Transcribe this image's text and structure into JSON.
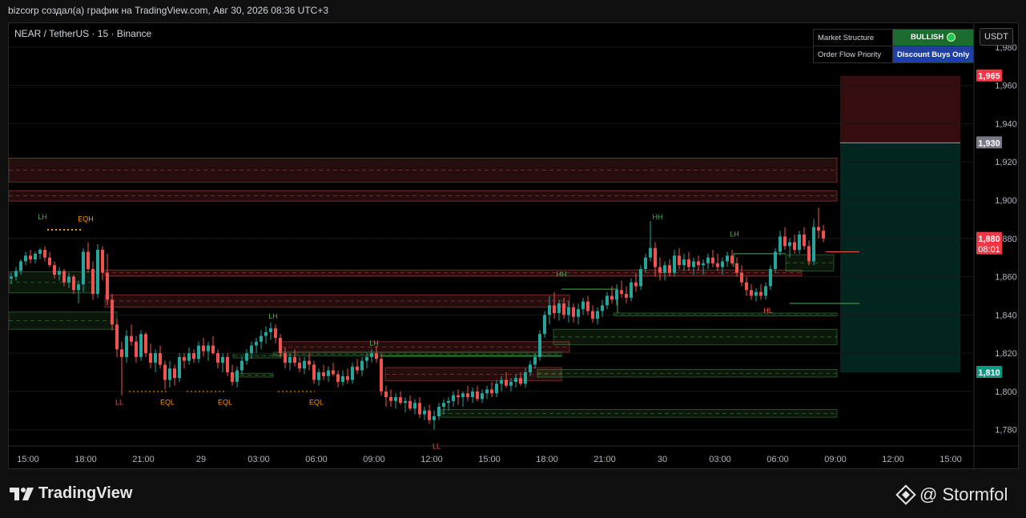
{
  "header": {
    "title": "bizcorp создал(а) график на TradingView.com, Авг 30, 2026 08:36 UTC+3"
  },
  "legend": {
    "symbol": "NEAR / TetherUS · 15 · Binance"
  },
  "status_table": {
    "rows": [
      {
        "label": "Market Structure",
        "value": "BULLISH",
        "color": "#1c6b2f"
      },
      {
        "label": "Order Flow Priority",
        "value": "Discount Buys Only",
        "color": "#1e3fa8"
      }
    ]
  },
  "currency": "USDT",
  "footer": {
    "brand": "TradingView",
    "watermark": "@ Stormfol"
  },
  "colors": {
    "bull": "#26a69a",
    "bear": "#ef5350",
    "structure_green": "#4caf50",
    "structure_red": "#ef5350",
    "eq_orange": "#ff9800"
  },
  "chart_data": {
    "type": "candlestick",
    "price_axis": {
      "ticks": [
        1.78,
        1.8,
        1.82,
        1.84,
        1.86,
        1.88,
        1.9,
        1.92,
        1.94,
        1.96,
        1.98
      ],
      "tick_labels": [
        "1,780",
        "1,800",
        "1,820",
        "1,840",
        "1,860",
        "1,880",
        "1,900",
        "1,920",
        "1,940",
        "1,960",
        "1,980"
      ],
      "ylim": [
        1.7715,
        1.9925
      ]
    },
    "time_axis": {
      "labels": [
        "15:00",
        "18:00",
        "21:00",
        "29",
        "03:00",
        "06:00",
        "09:00",
        "12:00",
        "15:00",
        "18:00",
        "21:00",
        "30",
        "03:00",
        "06:00",
        "09:00",
        "12:00",
        "15:00"
      ],
      "label_bars": [
        4,
        16,
        28,
        40,
        52,
        64,
        76,
        88,
        100,
        112,
        124,
        136,
        148,
        160,
        172,
        184,
        196
      ],
      "total_bars": 201
    },
    "price_markers": [
      {
        "label": "1,965",
        "value": 1.965,
        "color": "#f23645",
        "text_color": "#ffffff"
      },
      {
        "label": "1,930",
        "value": 1.93,
        "color": "#787b86",
        "text_color": "#ffffff"
      },
      {
        "label": "1,880",
        "sub": "08:01",
        "value": 1.88,
        "color": "#f23645",
        "text_color": "#ffffff"
      },
      {
        "label": "1,810",
        "value": 1.81,
        "color": "#089981",
        "text_color": "#ffffff"
      }
    ],
    "current_price": 1.88,
    "position": {
      "stop": 1.965,
      "entry": 1.93,
      "target": 1.81,
      "from_bar": 173,
      "to_bar": 198
    },
    "structure_labels": [
      {
        "text": "LH",
        "bar": 7,
        "price": 1.89,
        "color": "#4caf50"
      },
      {
        "text": "EQH",
        "bar": 16,
        "price": 1.889,
        "color": "#ff9800"
      },
      {
        "text": "LL",
        "bar": 23,
        "price": 1.793,
        "color": "#ef5350"
      },
      {
        "text": "EQL",
        "bar": 33,
        "price": 1.793,
        "color": "#ff9800"
      },
      {
        "text": "EQL",
        "bar": 45,
        "price": 1.793,
        "color": "#ff9800"
      },
      {
        "text": "LH",
        "bar": 55,
        "price": 1.838,
        "color": "#4caf50"
      },
      {
        "text": "EQL",
        "bar": 64,
        "price": 1.793,
        "color": "#ff9800"
      },
      {
        "text": "LH",
        "bar": 76,
        "price": 1.824,
        "color": "#4caf50"
      },
      {
        "text": "LL",
        "bar": 89,
        "price": 1.77,
        "color": "#ef5350"
      },
      {
        "text": "HH",
        "bar": 115,
        "price": 1.86,
        "color": "#4caf50"
      },
      {
        "text": "HH",
        "bar": 135,
        "price": 1.89,
        "color": "#4caf50"
      },
      {
        "text": "LH",
        "bar": 151,
        "price": 1.881,
        "color": "#4caf50"
      },
      {
        "text": "HL",
        "bar": 158,
        "price": 1.841,
        "color": "#ef5350"
      }
    ],
    "candles": [
      [
        1.859,
        1.862,
        1.856,
        1.86
      ],
      [
        1.86,
        1.865,
        1.858,
        1.863
      ],
      [
        1.863,
        1.869,
        1.861,
        1.868
      ],
      [
        1.868,
        1.873,
        1.866,
        1.871
      ],
      [
        1.871,
        1.874,
        1.867,
        1.869
      ],
      [
        1.869,
        1.873,
        1.867,
        1.872
      ],
      [
        1.872,
        1.875,
        1.869,
        1.874
      ],
      [
        1.874,
        1.876,
        1.868,
        1.87
      ],
      [
        1.87,
        1.873,
        1.865,
        1.866
      ],
      [
        1.866,
        1.868,
        1.859,
        1.861
      ],
      [
        1.861,
        1.865,
        1.858,
        1.863
      ],
      [
        1.863,
        1.864,
        1.855,
        1.857
      ],
      [
        1.857,
        1.862,
        1.854,
        1.86
      ],
      [
        1.86,
        1.861,
        1.851,
        1.853
      ],
      [
        1.853,
        1.858,
        1.846,
        1.856
      ],
      [
        1.856,
        1.875,
        1.852,
        1.873
      ],
      [
        1.873,
        1.878,
        1.862,
        1.864
      ],
      [
        1.864,
        1.868,
        1.848,
        1.851
      ],
      [
        1.851,
        1.877,
        1.849,
        1.874
      ],
      [
        1.874,
        1.876,
        1.858,
        1.862
      ],
      [
        1.862,
        1.872,
        1.845,
        1.848
      ],
      [
        1.848,
        1.851,
        1.832,
        1.835
      ],
      [
        1.835,
        1.838,
        1.818,
        1.822
      ],
      [
        1.822,
        1.826,
        1.798,
        1.818
      ],
      [
        1.818,
        1.832,
        1.815,
        1.829
      ],
      [
        1.829,
        1.835,
        1.824,
        1.826
      ],
      [
        1.826,
        1.829,
        1.815,
        1.818
      ],
      [
        1.818,
        1.832,
        1.816,
        1.83
      ],
      [
        1.83,
        1.831,
        1.818,
        1.82
      ],
      [
        1.82,
        1.825,
        1.812,
        1.815
      ],
      [
        1.815,
        1.822,
        1.81,
        1.82
      ],
      [
        1.82,
        1.824,
        1.812,
        1.814
      ],
      [
        1.814,
        1.816,
        1.801,
        1.806
      ],
      [
        1.806,
        1.816,
        1.802,
        1.812
      ],
      [
        1.812,
        1.814,
        1.803,
        1.807
      ],
      [
        1.807,
        1.82,
        1.805,
        1.818
      ],
      [
        1.818,
        1.82,
        1.812,
        1.816
      ],
      [
        1.816,
        1.823,
        1.814,
        1.82
      ],
      [
        1.82,
        1.822,
        1.815,
        1.817
      ],
      [
        1.817,
        1.826,
        1.815,
        1.824
      ],
      [
        1.824,
        1.828,
        1.818,
        1.821
      ],
      [
        1.821,
        1.826,
        1.816,
        1.824
      ],
      [
        1.824,
        1.829,
        1.819,
        1.82
      ],
      [
        1.82,
        1.822,
        1.812,
        1.815
      ],
      [
        1.815,
        1.82,
        1.81,
        1.818
      ],
      [
        1.818,
        1.82,
        1.808,
        1.81
      ],
      [
        1.81,
        1.814,
        1.803,
        1.805
      ],
      [
        1.805,
        1.813,
        1.802,
        1.811
      ],
      [
        1.811,
        1.818,
        1.809,
        1.816
      ],
      [
        1.816,
        1.822,
        1.814,
        1.82
      ],
      [
        1.82,
        1.826,
        1.817,
        1.824
      ],
      [
        1.824,
        1.828,
        1.82,
        1.826
      ],
      [
        1.826,
        1.832,
        1.822,
        1.829
      ],
      [
        1.829,
        1.834,
        1.825,
        1.831
      ],
      [
        1.831,
        1.836,
        1.827,
        1.833
      ],
      [
        1.833,
        1.835,
        1.825,
        1.828
      ],
      [
        1.828,
        1.83,
        1.818,
        1.82
      ],
      [
        1.82,
        1.823,
        1.812,
        1.815
      ],
      [
        1.815,
        1.82,
        1.811,
        1.818
      ],
      [
        1.818,
        1.822,
        1.813,
        1.815
      ],
      [
        1.815,
        1.818,
        1.81,
        1.812
      ],
      [
        1.812,
        1.818,
        1.809,
        1.816
      ],
      [
        1.816,
        1.82,
        1.811,
        1.814
      ],
      [
        1.814,
        1.816,
        1.804,
        1.806
      ],
      [
        1.806,
        1.812,
        1.803,
        1.81
      ],
      [
        1.81,
        1.814,
        1.806,
        1.808
      ],
      [
        1.808,
        1.813,
        1.805,
        1.811
      ],
      [
        1.811,
        1.815,
        1.808,
        1.809
      ],
      [
        1.809,
        1.811,
        1.802,
        1.805
      ],
      [
        1.805,
        1.811,
        1.803,
        1.808
      ],
      [
        1.808,
        1.812,
        1.804,
        1.806
      ],
      [
        1.806,
        1.815,
        1.804,
        1.813
      ],
      [
        1.813,
        1.817,
        1.809,
        1.811
      ],
      [
        1.811,
        1.818,
        1.808,
        1.816
      ],
      [
        1.816,
        1.82,
        1.812,
        1.818
      ],
      [
        1.818,
        1.822,
        1.815,
        1.82
      ],
      [
        1.82,
        1.824,
        1.815,
        1.817
      ],
      [
        1.817,
        1.82,
        1.798,
        1.8
      ],
      [
        1.8,
        1.803,
        1.792,
        1.797
      ],
      [
        1.797,
        1.801,
        1.792,
        1.795
      ],
      [
        1.795,
        1.799,
        1.791,
        1.797
      ],
      [
        1.797,
        1.8,
        1.793,
        1.794
      ],
      [
        1.794,
        1.797,
        1.789,
        1.795
      ],
      [
        1.795,
        1.798,
        1.79,
        1.791
      ],
      [
        1.791,
        1.796,
        1.788,
        1.794
      ],
      [
        1.794,
        1.797,
        1.786,
        1.788
      ],
      [
        1.788,
        1.792,
        1.785,
        1.79
      ],
      [
        1.79,
        1.793,
        1.783,
        1.785
      ],
      [
        1.785,
        1.79,
        1.78,
        1.787
      ],
      [
        1.787,
        1.794,
        1.785,
        1.792
      ],
      [
        1.792,
        1.796,
        1.788,
        1.794
      ],
      [
        1.794,
        1.797,
        1.79,
        1.795
      ],
      [
        1.795,
        1.8,
        1.792,
        1.798
      ],
      [
        1.798,
        1.801,
        1.793,
        1.797
      ],
      [
        1.797,
        1.8,
        1.792,
        1.799
      ],
      [
        1.799,
        1.803,
        1.795,
        1.797
      ],
      [
        1.797,
        1.802,
        1.794,
        1.8
      ],
      [
        1.8,
        1.803,
        1.795,
        1.796
      ],
      [
        1.796,
        1.801,
        1.794,
        1.799
      ],
      [
        1.799,
        1.803,
        1.796,
        1.801
      ],
      [
        1.801,
        1.805,
        1.797,
        1.799
      ],
      [
        1.799,
        1.806,
        1.797,
        1.804
      ],
      [
        1.804,
        1.808,
        1.8,
        1.806
      ],
      [
        1.806,
        1.81,
        1.802,
        1.803
      ],
      [
        1.803,
        1.807,
        1.8,
        1.805
      ],
      [
        1.805,
        1.809,
        1.802,
        1.807
      ],
      [
        1.807,
        1.81,
        1.803,
        1.804
      ],
      [
        1.804,
        1.812,
        1.802,
        1.81
      ],
      [
        1.81,
        1.816,
        1.808,
        1.814
      ],
      [
        1.814,
        1.82,
        1.812,
        1.818
      ],
      [
        1.818,
        1.832,
        1.816,
        1.83
      ],
      [
        1.83,
        1.842,
        1.828,
        1.84
      ],
      [
        1.84,
        1.85,
        1.835,
        1.845
      ],
      [
        1.845,
        1.852,
        1.838,
        1.841
      ],
      [
        1.841,
        1.848,
        1.837,
        1.846
      ],
      [
        1.846,
        1.849,
        1.838,
        1.84
      ],
      [
        1.84,
        1.847,
        1.836,
        1.844
      ],
      [
        1.844,
        1.846,
        1.836,
        1.839
      ],
      [
        1.839,
        1.846,
        1.835,
        1.843
      ],
      [
        1.843,
        1.849,
        1.84,
        1.847
      ],
      [
        1.847,
        1.85,
        1.84,
        1.842
      ],
      [
        1.842,
        1.845,
        1.836,
        1.838
      ],
      [
        1.838,
        1.844,
        1.835,
        1.842
      ],
      [
        1.842,
        1.848,
        1.839,
        1.845
      ],
      [
        1.845,
        1.852,
        1.843,
        1.85
      ],
      [
        1.85,
        1.855,
        1.846,
        1.848
      ],
      [
        1.848,
        1.856,
        1.845,
        1.853
      ],
      [
        1.853,
        1.858,
        1.849,
        1.851
      ],
      [
        1.851,
        1.855,
        1.846,
        1.849
      ],
      [
        1.849,
        1.859,
        1.847,
        1.857
      ],
      [
        1.857,
        1.862,
        1.852,
        1.855
      ],
      [
        1.855,
        1.866,
        1.853,
        1.864
      ],
      [
        1.864,
        1.872,
        1.862,
        1.87
      ],
      [
        1.87,
        1.889,
        1.868,
        1.875
      ],
      [
        1.875,
        1.878,
        1.86,
        1.865
      ],
      [
        1.865,
        1.87,
        1.858,
        1.862
      ],
      [
        1.862,
        1.868,
        1.858,
        1.866
      ],
      [
        1.866,
        1.869,
        1.86,
        1.862
      ],
      [
        1.862,
        1.874,
        1.86,
        1.871
      ],
      [
        1.871,
        1.875,
        1.864,
        1.866
      ],
      [
        1.866,
        1.872,
        1.863,
        1.869
      ],
      [
        1.869,
        1.873,
        1.863,
        1.865
      ],
      [
        1.865,
        1.87,
        1.861,
        1.868
      ],
      [
        1.868,
        1.871,
        1.863,
        1.866
      ],
      [
        1.866,
        1.869,
        1.861,
        1.867
      ],
      [
        1.867,
        1.872,
        1.864,
        1.87
      ],
      [
        1.87,
        1.874,
        1.865,
        1.867
      ],
      [
        1.867,
        1.872,
        1.863,
        1.865
      ],
      [
        1.865,
        1.87,
        1.861,
        1.868
      ],
      [
        1.868,
        1.873,
        1.865,
        1.871
      ],
      [
        1.871,
        1.874,
        1.866,
        1.867
      ],
      [
        1.867,
        1.87,
        1.86,
        1.862
      ],
      [
        1.862,
        1.866,
        1.855,
        1.857
      ],
      [
        1.857,
        1.86,
        1.85,
        1.853
      ],
      [
        1.853,
        1.856,
        1.848,
        1.85
      ],
      [
        1.85,
        1.854,
        1.847,
        1.852
      ],
      [
        1.852,
        1.856,
        1.848,
        1.85
      ],
      [
        1.85,
        1.857,
        1.848,
        1.855
      ],
      [
        1.855,
        1.866,
        1.853,
        1.864
      ],
      [
        1.864,
        1.875,
        1.862,
        1.873
      ],
      [
        1.873,
        1.884,
        1.871,
        1.881
      ],
      [
        1.881,
        1.886,
        1.874,
        1.876
      ],
      [
        1.876,
        1.88,
        1.87,
        1.878
      ],
      [
        1.878,
        1.882,
        1.872,
        1.874
      ],
      [
        1.874,
        1.884,
        1.872,
        1.882
      ],
      [
        1.882,
        1.886,
        1.874,
        1.876
      ],
      [
        1.876,
        1.879,
        1.866,
        1.868
      ],
      [
        1.868,
        1.89,
        1.866,
        1.886
      ],
      [
        1.886,
        1.896,
        1.88,
        1.884
      ],
      [
        1.884,
        1.887,
        1.878,
        1.88
      ]
    ]
  }
}
